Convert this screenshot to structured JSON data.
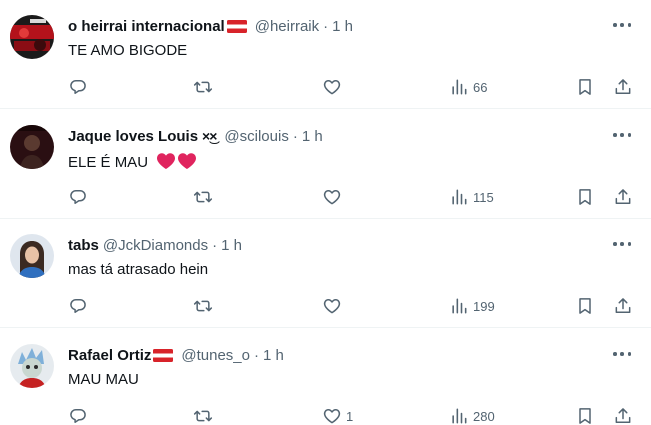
{
  "replies": [
    {
      "name": "o heirrai internacional",
      "has_flag": true,
      "handle": "@heirraik",
      "separator": "·",
      "time": "1 h",
      "text": "TE AMO BIGODE",
      "likes": "",
      "views": "66"
    },
    {
      "name": "Jaque loves Louis",
      "name_suffix": "×͜×",
      "handle": "@scilouis",
      "separator": "·",
      "time": "1 h",
      "text": "ELE É MAU",
      "hearts": 2,
      "likes": "",
      "views": "115"
    },
    {
      "name": "tabs",
      "handle": "@JckDiamonds",
      "separator": "·",
      "time": "1 h",
      "text": "mas tá atrasado hein",
      "likes": "",
      "views": "199"
    },
    {
      "name": "Rafael Ortiz",
      "has_flag": true,
      "handle": "@tunes_o",
      "separator": "·",
      "time": "1 h",
      "text": "MAU MAU",
      "likes": "1",
      "views": "280"
    }
  ],
  "colors": {
    "text": "#0f1419",
    "muted": "#536471",
    "divider": "#eff3f4",
    "heart_emoji": "#e0245e",
    "flag_red": "#d8232a"
  },
  "icons": {
    "reply": "reply-icon",
    "retweet": "retweet-icon",
    "like": "heart-icon",
    "views": "views-icon",
    "bookmark": "bookmark-icon",
    "share": "share-icon",
    "more": "more-icon"
  }
}
